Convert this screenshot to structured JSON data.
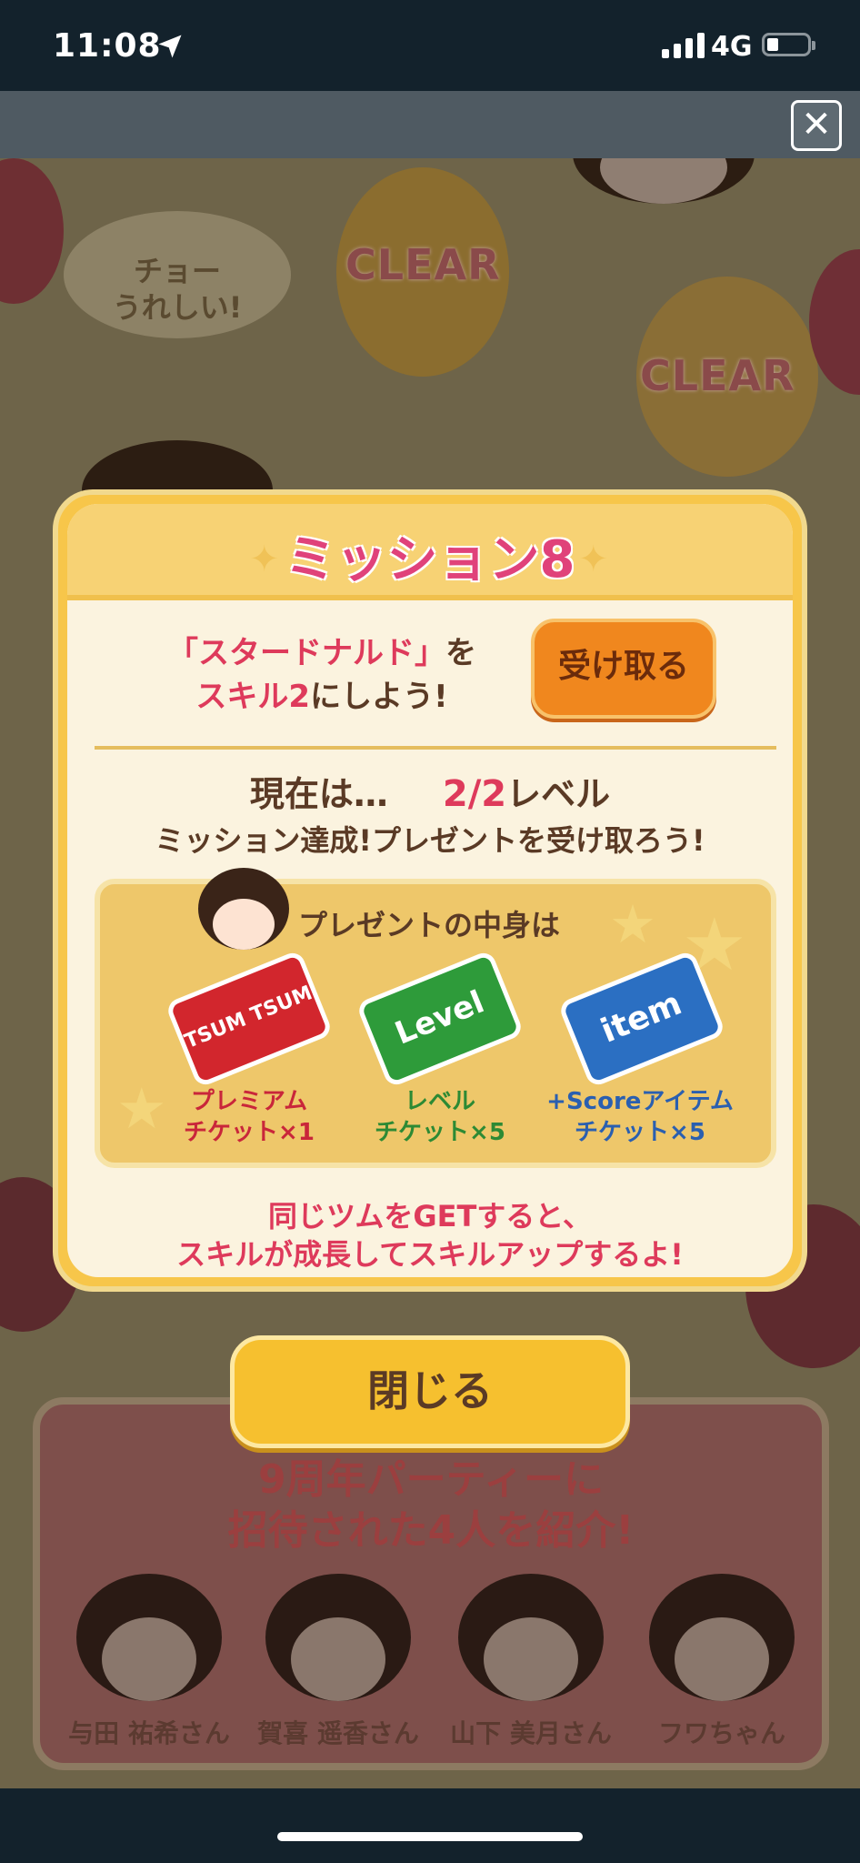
{
  "status_bar": {
    "time": "11:08",
    "network": "4G"
  },
  "scene": {
    "clear_label_1": "CLEAR",
    "clear_label_2": "CLEAR",
    "speech_bubble": "チョー\nうれしい!"
  },
  "modal": {
    "title": "ミッション8",
    "mission_line1_prefix": "「スタードナルド」",
    "mission_line1_suffix": "を",
    "mission_line2_highlight": "スキル2",
    "mission_line2_suffix": "にしよう!",
    "receive_button": "受け取る",
    "current_label": "現在は…",
    "current_value": "2/2",
    "current_unit": "レベル",
    "achieved_text": "ミッション達成!プレゼントを受け取ろう!",
    "present_heading": "プレゼントの中身は",
    "rewards": [
      {
        "ticket_text": "TSUM TSUM",
        "label_line1": "プレミアム",
        "label_line2": "チケット×1",
        "color": "#d2262d",
        "label_color": "#c9263a"
      },
      {
        "ticket_text": "Level",
        "label_line1": "レベル",
        "label_line2": "チケット×5",
        "color": "#2e9b3a",
        "label_color": "#2d8a34"
      },
      {
        "ticket_text": "item",
        "label_line1": "+Scoreアイテム",
        "label_line2": "チケット×5",
        "color": "#2b6fc2",
        "label_color": "#2a5fb0"
      }
    ],
    "footer_line1": "同じツムをGETすると、",
    "footer_line2": "スキルが成長してスキルアップするよ!"
  },
  "close_button": "閉じる",
  "intro": {
    "title_line1": "9周年パーティーに",
    "title_line2": "招待された4人を紹介!",
    "members": [
      {
        "name": "与田 祐希さん"
      },
      {
        "name": "賀喜 遥香さん"
      },
      {
        "name": "山下 美月さん"
      },
      {
        "name": "フワちゃん"
      }
    ]
  },
  "colors": {
    "accent_pink": "#de3a5b",
    "modal_gold": "#f7c64a",
    "button_orange": "#f0871e"
  }
}
